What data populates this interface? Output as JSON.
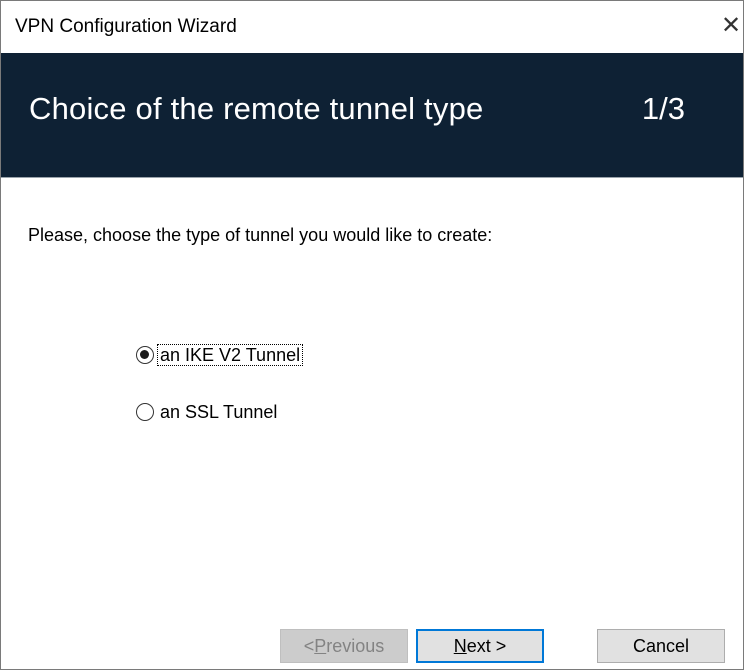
{
  "window": {
    "title": "VPN Configuration Wizard",
    "close_glyph": "✕"
  },
  "banner": {
    "heading": "Choice of the remote tunnel type",
    "step": "1/3",
    "background_color": "#0e2134"
  },
  "prompt": "Please, choose the type of tunnel you would like to create:",
  "tunnel_options": [
    {
      "label": "an IKE V2 Tunnel",
      "selected": true
    },
    {
      "label": "an SSL Tunnel",
      "selected": false
    }
  ],
  "buttons": {
    "previous_prefix": "< ",
    "previous_access_key": "P",
    "previous_rest": "revious",
    "previous_enabled": false,
    "next_access_key": "N",
    "next_rest": "ext >",
    "cancel": "Cancel"
  },
  "colors": {
    "focus_border": "#0078d7"
  }
}
